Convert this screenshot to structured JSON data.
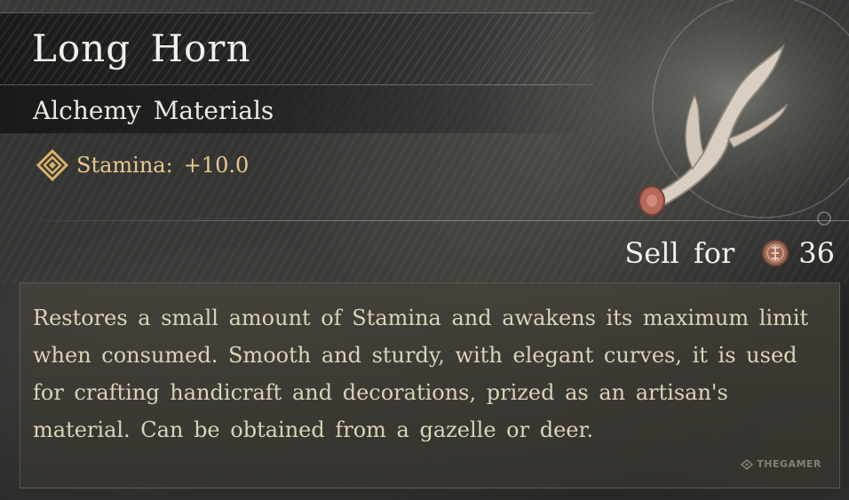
{
  "item": {
    "name": "Long Horn",
    "category": "Alchemy Materials",
    "stat": {
      "label": "Stamina:",
      "value": "+10.0",
      "icon": "stamina-diamond-icon"
    }
  },
  "sell": {
    "label": "Sell for",
    "price": "36",
    "icon": "coin-icon"
  },
  "description": "Restores a small amount of Stamina and awakens its maximum limit when consumed. Smooth and sturdy, with elegant curves, it is used for crafting handicraft and decorations, prized as an artisan's material. Can be obtained from a gazelle or deer.",
  "watermark": "THEGAMER",
  "colors": {
    "stat": "#e7c98d",
    "title": "#f1f0ea",
    "description": "#ddd2ba"
  }
}
